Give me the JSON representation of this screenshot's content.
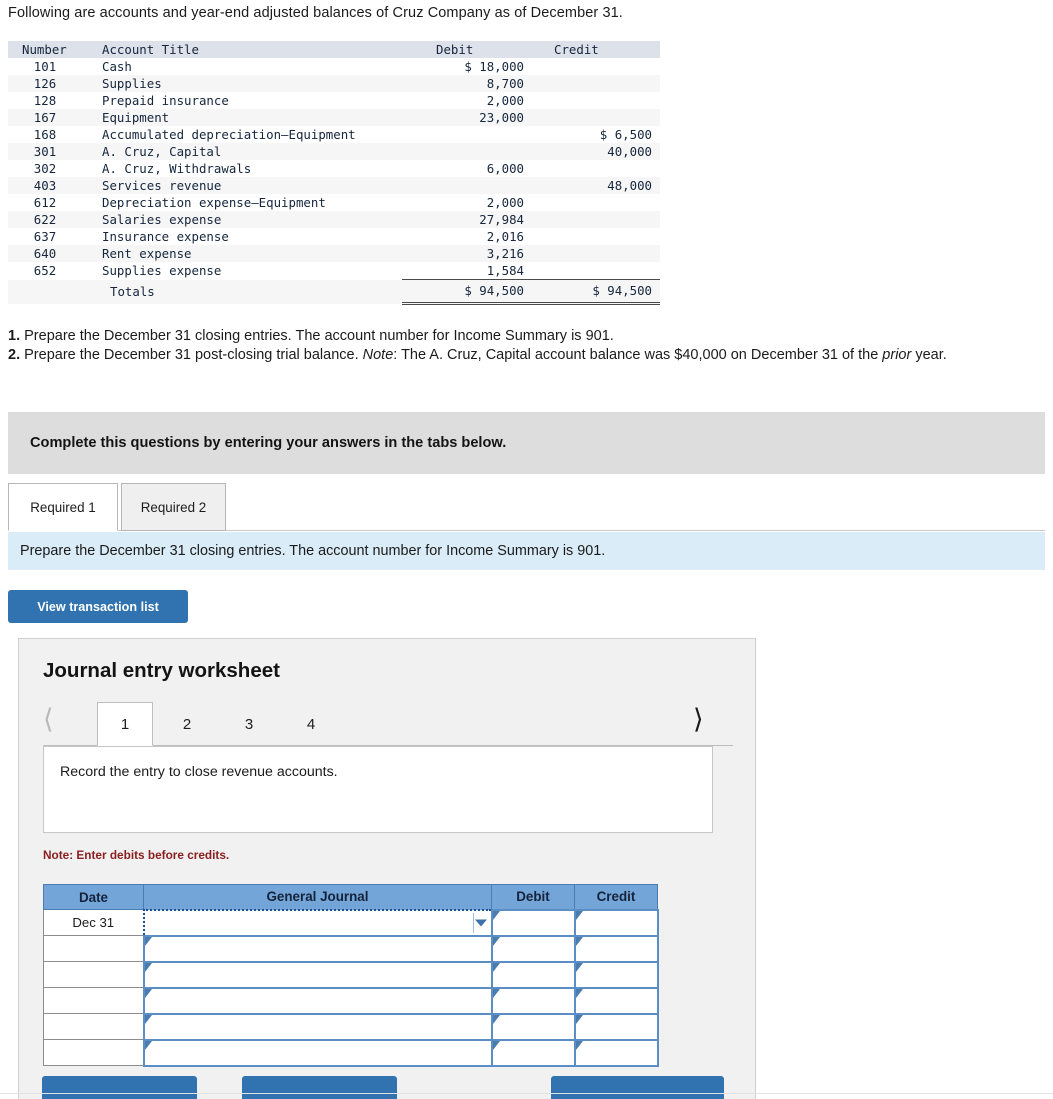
{
  "intro": "Following are accounts and year-end adjusted balances of Cruz Company as of December 31.",
  "trial_balance": {
    "headers": [
      "Number",
      "Account Title",
      "Debit",
      "Credit"
    ],
    "rows": [
      {
        "number": "101",
        "title": "Cash",
        "debit": "$ 18,000",
        "credit": ""
      },
      {
        "number": "126",
        "title": "Supplies",
        "debit": "8,700",
        "credit": ""
      },
      {
        "number": "128",
        "title": "Prepaid insurance",
        "debit": "2,000",
        "credit": ""
      },
      {
        "number": "167",
        "title": "Equipment",
        "debit": "23,000",
        "credit": ""
      },
      {
        "number": "168",
        "title": "Accumulated depreciation—Equipment",
        "debit": "",
        "credit": "$ 6,500"
      },
      {
        "number": "301",
        "title": "A. Cruz, Capital",
        "debit": "",
        "credit": "40,000"
      },
      {
        "number": "302",
        "title": "A. Cruz, Withdrawals",
        "debit": "6,000",
        "credit": ""
      },
      {
        "number": "403",
        "title": "Services revenue",
        "debit": "",
        "credit": "48,000"
      },
      {
        "number": "612",
        "title": "Depreciation expense—Equipment",
        "debit": "2,000",
        "credit": ""
      },
      {
        "number": "622",
        "title": "Salaries expense",
        "debit": "27,984",
        "credit": ""
      },
      {
        "number": "637",
        "title": "Insurance expense",
        "debit": "2,016",
        "credit": ""
      },
      {
        "number": "640",
        "title": "Rent expense",
        "debit": "3,216",
        "credit": ""
      },
      {
        "number": "652",
        "title": "Supplies expense",
        "debit": "1,584",
        "credit": ""
      }
    ],
    "totals": {
      "number": "",
      "title": "Totals",
      "debit": "$ 94,500",
      "credit": "$ 94,500"
    }
  },
  "requirements": {
    "item1_num": "1.",
    "item1_text": "Prepare the December 31 closing entries. The account number for Income Summary is 901.",
    "item2_num": "2.",
    "item2_lead": "Prepare the December 31 post-closing trial balance.",
    "item2_note_label": "Note",
    "item2_note_text": ": The A. Cruz, Capital account balance was $40,000 on December 31 of the",
    "item2_tail_pre": " ",
    "item2_italic": "prior",
    "item2_tail": " year."
  },
  "banner": {
    "text": "Complete this questions by entering your answers in the tabs below."
  },
  "tabs": [
    {
      "label": "Required 1",
      "active": true
    },
    {
      "label": "Required 2",
      "active": false
    }
  ],
  "infobar": {
    "text": "Prepare the December 31 closing entries. The account number for Income Summary is 901."
  },
  "view_transaction_button": {
    "label": "View transaction list"
  },
  "worksheet": {
    "title": "Journal entry worksheet",
    "pages": [
      "1",
      "2",
      "3",
      "4"
    ],
    "active_page": "1",
    "prev_icon": "chevron-left-icon",
    "next_icon": "chevron-right-icon",
    "prompt": "Record the entry to close revenue accounts.",
    "note": "Note: Enter debits before credits.",
    "journal": {
      "headers": [
        "Date",
        "General Journal",
        "Debit",
        "Credit"
      ],
      "rows": [
        {
          "date": "Dec 31",
          "general_journal": "",
          "debit": "",
          "credit": "",
          "selected": true
        },
        {
          "date": "",
          "general_journal": "",
          "debit": "",
          "credit": "",
          "selected": false
        },
        {
          "date": "",
          "general_journal": "",
          "debit": "",
          "credit": "",
          "selected": false
        },
        {
          "date": "",
          "general_journal": "",
          "debit": "",
          "credit": "",
          "selected": false
        },
        {
          "date": "",
          "general_journal": "",
          "debit": "",
          "credit": "",
          "selected": false
        },
        {
          "date": "",
          "general_journal": "",
          "debit": "",
          "credit": "",
          "selected": false
        }
      ]
    }
  },
  "bottom_buttons": [
    {
      "label": ""
    },
    {
      "label": ""
    },
    {
      "label": ""
    }
  ],
  "colors": {
    "accent_blue": "#3173b0",
    "table_header_blue": "#74a5d8",
    "info_blue": "#d9ecf7",
    "banner_gray": "#dddddd",
    "panel_gray": "#f1f1f1",
    "note_red": "#8a2020",
    "tb_header": "#dde1ea"
  }
}
